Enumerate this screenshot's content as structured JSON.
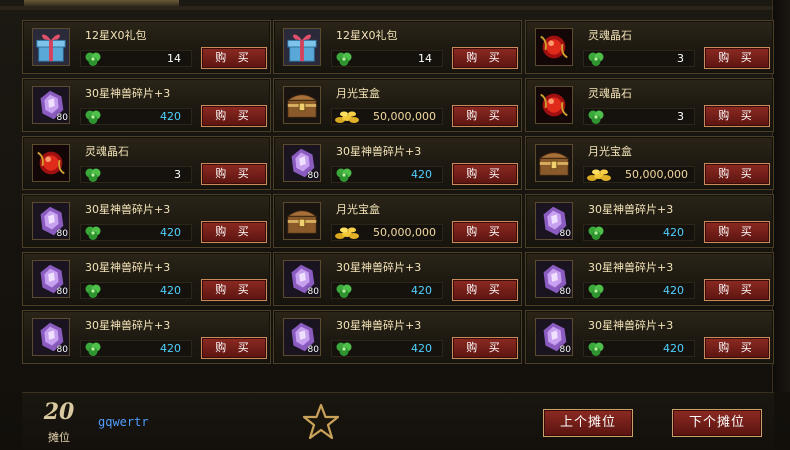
{
  "buy_label": "购 买",
  "items": [
    {
      "name": "12星X0礼包",
      "icon": "gift-box-icon",
      "level": "",
      "price": "14",
      "currency": "jade",
      "price_style": "white"
    },
    {
      "name": "12星X0礼包",
      "icon": "gift-box-icon",
      "level": "",
      "price": "14",
      "currency": "jade",
      "price_style": "white"
    },
    {
      "name": "灵魂晶石",
      "icon": "soul-crystal-icon",
      "level": "",
      "price": "3",
      "currency": "jade",
      "price_style": "white"
    },
    {
      "name": "30星神兽碎片+3",
      "icon": "beast-shard-icon",
      "level": "80",
      "price": "420",
      "currency": "jade",
      "price_style": "blue"
    },
    {
      "name": "月光宝盒",
      "icon": "treasure-chest-icon",
      "level": "",
      "price": "50,000,000",
      "currency": "gold",
      "price_style": "gold"
    },
    {
      "name": "灵魂晶石",
      "icon": "soul-crystal-icon",
      "level": "",
      "price": "3",
      "currency": "jade",
      "price_style": "white"
    },
    {
      "name": "灵魂晶石",
      "icon": "soul-crystal-icon",
      "level": "",
      "price": "3",
      "currency": "jade",
      "price_style": "white"
    },
    {
      "name": "30星神兽碎片+3",
      "icon": "beast-shard-icon",
      "level": "80",
      "price": "420",
      "currency": "jade",
      "price_style": "blue"
    },
    {
      "name": "月光宝盒",
      "icon": "treasure-chest-icon",
      "level": "",
      "price": "50,000,000",
      "currency": "gold",
      "price_style": "gold"
    },
    {
      "name": "30星神兽碎片+3",
      "icon": "beast-shard-icon",
      "level": "80",
      "price": "420",
      "currency": "jade",
      "price_style": "blue"
    },
    {
      "name": "月光宝盒",
      "icon": "treasure-chest-icon",
      "level": "",
      "price": "50,000,000",
      "currency": "gold",
      "price_style": "gold"
    },
    {
      "name": "30星神兽碎片+3",
      "icon": "beast-shard-icon",
      "level": "80",
      "price": "420",
      "currency": "jade",
      "price_style": "blue"
    },
    {
      "name": "30星神兽碎片+3",
      "icon": "beast-shard-icon",
      "level": "80",
      "price": "420",
      "currency": "jade",
      "price_style": "blue"
    },
    {
      "name": "30星神兽碎片+3",
      "icon": "beast-shard-icon",
      "level": "80",
      "price": "420",
      "currency": "jade",
      "price_style": "blue"
    },
    {
      "name": "30星神兽碎片+3",
      "icon": "beast-shard-icon",
      "level": "80",
      "price": "420",
      "currency": "jade",
      "price_style": "blue"
    },
    {
      "name": "30星神兽碎片+3",
      "icon": "beast-shard-icon",
      "level": "80",
      "price": "420",
      "currency": "jade",
      "price_style": "blue"
    },
    {
      "name": "30星神兽碎片+3",
      "icon": "beast-shard-icon",
      "level": "80",
      "price": "420",
      "currency": "jade",
      "price_style": "blue"
    },
    {
      "name": "30星神兽碎片+3",
      "icon": "beast-shard-icon",
      "level": "80",
      "price": "420",
      "currency": "jade",
      "price_style": "blue"
    }
  ],
  "footer": {
    "stall_number": "20",
    "stall_caption": "摊位",
    "player_name": "gqwertr",
    "favorite_icon": "star-outline-icon",
    "prev_label": "上个摊位",
    "next_label": "下个摊位"
  },
  "colors": {
    "buy_button": "#7a2018",
    "price_blue": "#4fd0ff",
    "player_name": "#4f9cff",
    "title_text": "#f3e3b8"
  }
}
